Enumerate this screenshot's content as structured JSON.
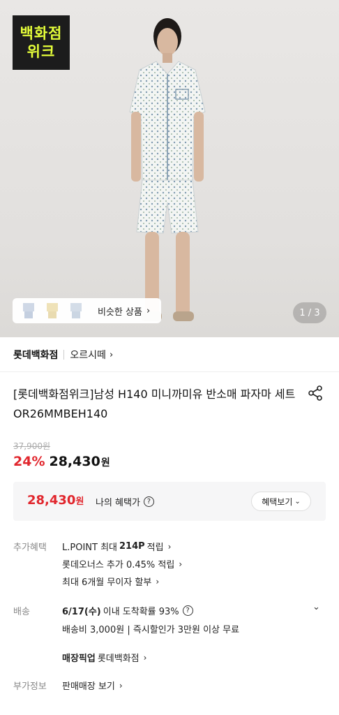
{
  "hero": {
    "badge_line1": "백화점",
    "badge_line2": "위크",
    "similar_label": "비슷한 상품",
    "counter": "1 / 3"
  },
  "store": {
    "name": "롯데백화점",
    "brand": "오르시떼"
  },
  "product": {
    "title": "[롯데백화점위크]남성 H140 미니까미유 반소매 파자마 세트 OR26MMBEH140",
    "original_price": "37,900원",
    "discount": "24%",
    "sale_price": "28,430",
    "sale_unit": "원"
  },
  "benefit": {
    "price": "28,430",
    "unit": "원",
    "label": "나의 혜택가",
    "button": "혜택보기"
  },
  "extra_benefits": {
    "label": "추가혜택",
    "line1_pre": "L.POINT 최대",
    "line1_bold": "214P",
    "line1_post": "적립",
    "line2": "롯데오너스 추가 0.45% 적립",
    "line3": "최대 6개월 무이자 할부"
  },
  "shipping": {
    "label": "배송",
    "date_bold": "6/17(수)",
    "date_post": "이내 도착확률 93%",
    "fee": "배송비 3,000원 | 즉시할인가 3만원 이상 무료",
    "pickup_bold": "매장픽업",
    "pickup_post": "롯데백화점"
  },
  "additional_info": {
    "label": "부가정보",
    "text": "판매매장 보기"
  },
  "colors": {
    "accent_red": "#e1262d",
    "badge_bg": "#1c1c1c",
    "badge_text": "#e6ff3a"
  }
}
